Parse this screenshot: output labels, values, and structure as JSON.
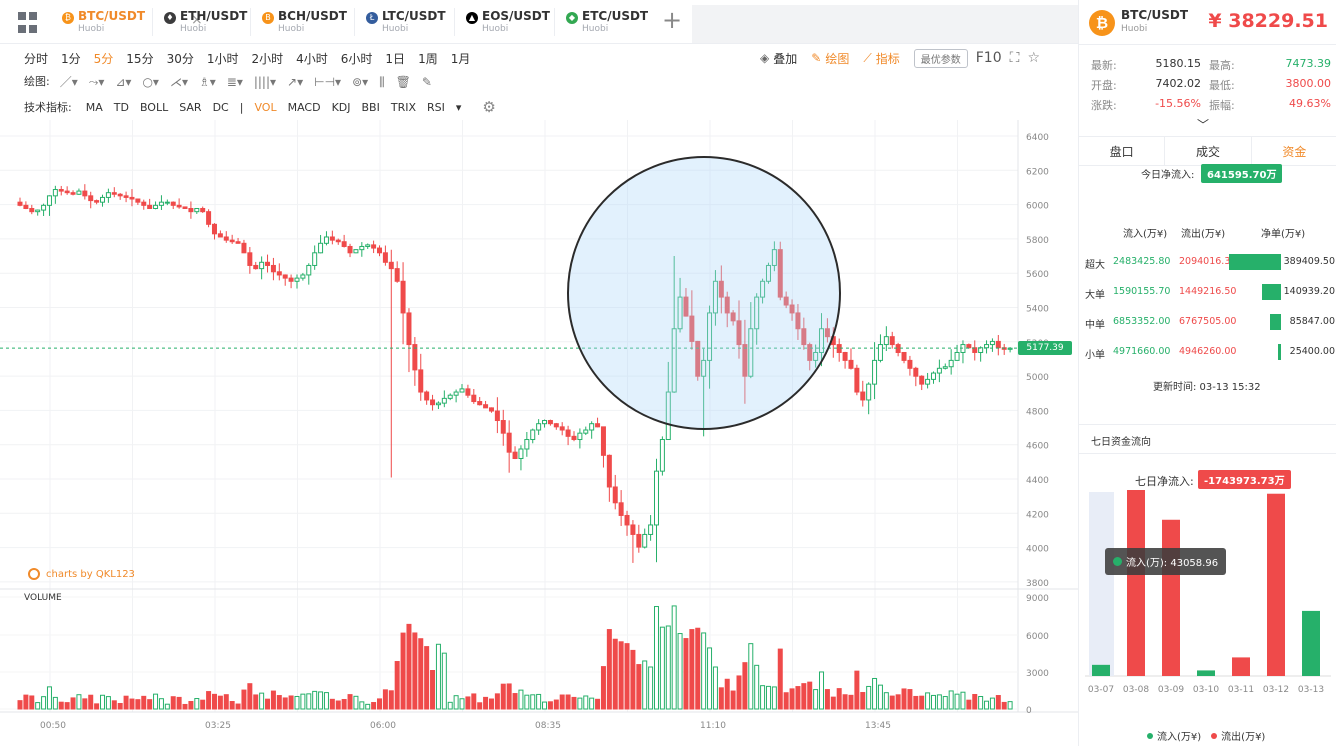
{
  "tabs": [
    {
      "pair": "BTC/USDT",
      "exchange": "Huobi",
      "active": true,
      "coin_color": "#f7931a",
      "coin_glyph": "₿"
    },
    {
      "pair": "ETH/USDT",
      "exchange": "Huobi",
      "active": false,
      "coin_color": "#3c3c3d",
      "coin_glyph": "♦"
    },
    {
      "pair": "BCH/USDT",
      "exchange": "Huobi",
      "active": false,
      "coin_color": "#f7931a",
      "coin_glyph": "B"
    },
    {
      "pair": "LTC/USDT",
      "exchange": "Huobi",
      "active": false,
      "coin_color": "#345d9d",
      "coin_glyph": "Ł"
    },
    {
      "pair": "EOS/USDT",
      "exchange": "Huobi",
      "active": false,
      "coin_color": "#000000",
      "coin_glyph": "▲"
    },
    {
      "pair": "ETC/USDT",
      "exchange": "Huobi",
      "active": false,
      "coin_color": "#33a852",
      "coin_glyph": "◆"
    }
  ],
  "periods": [
    "分时",
    "1分",
    "5分",
    "15分",
    "30分",
    "1小时",
    "2小时",
    "4小时",
    "6小时",
    "1日",
    "1周",
    "1月"
  ],
  "active_period": "5分",
  "toolbar_right": {
    "overlay": "叠加",
    "draw": "绘图",
    "indicator": "指标",
    "optimal": "最优参数",
    "f10": "F10"
  },
  "draw_label": "绘图:",
  "draw_tools": [
    "／▾",
    "⤳▾",
    "⊿▾",
    "○▾",
    "⋌▾",
    "♗▾",
    "≣▾",
    "||||▾",
    "↗▾",
    "⊢⊣▾",
    "⊚▾",
    "⫼",
    "🗑",
    "✎"
  ],
  "indicators_label": "技术指标:",
  "indicators": [
    "MA",
    "TD",
    "BOLL",
    "SAR",
    "DC",
    "|",
    "VOL",
    "MACD",
    "KDJ",
    "BBI",
    "TRIX",
    "RSI",
    "▾"
  ],
  "active_indicator": "VOL",
  "colors": {
    "up": "#26b06a",
    "down": "#ef4a4a",
    "accent": "#f08a2a"
  },
  "chart_data": {
    "type": "candlestick",
    "price_axis_ticks": [
      "6400",
      "6200",
      "6000",
      "5800",
      "5600",
      "5400",
      "5200",
      "5000",
      "4800",
      "4600",
      "4400",
      "4200",
      "4000",
      "3800"
    ],
    "volume_axis_ticks": [
      "9000",
      "6000",
      "3000",
      "0"
    ],
    "time_ticks": [
      "00:50",
      "03:25",
      "06:00",
      "08:35",
      "11:10",
      "13:45"
    ],
    "current_price_label": "5177.39",
    "current_price": 5177.39,
    "price_range": [
      3750,
      6500
    ],
    "volume_range": [
      0,
      9000
    ],
    "watermark": "charts by QKL123",
    "volume_label": "VOLUME",
    "close_path": [
      6080,
      6060,
      6040,
      6050,
      6080,
      6140,
      6180,
      6170,
      6160,
      6150,
      6170,
      6140,
      6110,
      6100,
      6130,
      6160,
      6150,
      6140,
      6130,
      6120,
      6100,
      6080,
      6060,
      6080,
      6100,
      6100,
      6080,
      6070,
      6060,
      6040,
      6060,
      6040,
      5960,
      5900,
      5880,
      5860,
      5850,
      5840,
      5780,
      5700,
      5680,
      5720,
      5700,
      5660,
      5640,
      5620,
      5600,
      5620,
      5640,
      5700,
      5780,
      5840,
      5880,
      5860,
      5850,
      5820,
      5780,
      5800,
      5820,
      5830,
      5810,
      5780,
      5720,
      5680,
      5600,
      5400,
      5200,
      5040,
      4900,
      4850,
      4820,
      4830,
      4860,
      4880,
      4900,
      4920,
      4880,
      4840,
      4820,
      4800,
      4780,
      4720,
      4640,
      4520,
      4480,
      4540,
      4600,
      4660,
      4700,
      4720,
      4700,
      4680,
      4660,
      4620,
      4600,
      4640,
      4660,
      4700,
      4680,
      4500,
      4300,
      4200,
      4120,
      4060,
      4000,
      3920,
      4000,
      4060,
      4400,
      4600,
      4900,
      5300,
      5500,
      5380,
      5220,
      5000,
      5100,
      5400,
      5600,
      5500,
      5400,
      5350,
      5200,
      5000,
      5300,
      5500,
      5600,
      5700,
      5800,
      5500,
      5450,
      5400,
      5300,
      5200,
      5100,
      5150,
      5300,
      5250,
      5200,
      5150,
      5100,
      5050,
      4900,
      4850,
      4950,
      5100,
      5200,
      5250,
      5200,
      5150,
      5100,
      5050,
      5000,
      4950,
      4980,
      5020,
      5050,
      5060,
      5100,
      5150,
      5200,
      5180,
      5150,
      5180,
      5200,
      5220,
      5180,
      5170,
      5177
    ]
  },
  "panel": {
    "pair": "BTC/USDT",
    "exchange": "Huobi",
    "price": "¥ 38229.51",
    "stats": [
      {
        "k": "最新:",
        "v": "5180.15",
        "k2": "最高:",
        "v2": "7473.39"
      },
      {
        "k": "开盘:",
        "v": "7402.02",
        "k2": "最低:",
        "v2": "3800.00"
      },
      {
        "k": "涨跌:",
        "v": "-15.56%",
        "k2": "振幅:",
        "v2": "49.63%"
      }
    ],
    "tabs": [
      "盘口",
      "成交",
      "资金"
    ],
    "active_tab": "资金",
    "today_label": "今日净流入:",
    "today_value": "641595.70万",
    "flow_headers": [
      "流入(万¥)",
      "流出(万¥)",
      "净单(万¥)"
    ],
    "flows": [
      {
        "k": "超大",
        "in": "2483425.80",
        "out": "2094016.30",
        "net": "389409.50",
        "net_value": 389409.5
      },
      {
        "k": "大单",
        "in": "1590155.70",
        "out": "1449216.50",
        "net": "140939.20",
        "net_value": 140939.2
      },
      {
        "k": "中单",
        "in": "6853352.00",
        "out": "6767505.00",
        "net": "85847.00",
        "net_value": 85847.0
      },
      {
        "k": "小单",
        "in": "4971660.00",
        "out": "4946260.00",
        "net": "25400.00",
        "net_value": 25400.0
      }
    ],
    "updated": "更新时间: 03-13 15:32",
    "seven_day_title": "七日资金流向",
    "seven_label": "七日净流入:",
    "seven_value": "-1743973.73万",
    "tooltip": "流入(万): 43058.96",
    "legend_in": "流入(万¥)",
    "legend_out": "流出(万¥)",
    "seven_day": {
      "dates": [
        "03-07",
        "03-08",
        "03-09",
        "03-10",
        "03-11",
        "03-12",
        "03-13"
      ],
      "values": [
        0.06,
        1.0,
        0.84,
        0.03,
        0.1,
        0.98,
        0.35
      ],
      "colors": [
        "#26b06a",
        "#ef4a4a",
        "#ef4a4a",
        "#26b06a",
        "#ef4a4a",
        "#ef4a4a",
        "#26b06a"
      ],
      "highlight_index": 0
    }
  }
}
